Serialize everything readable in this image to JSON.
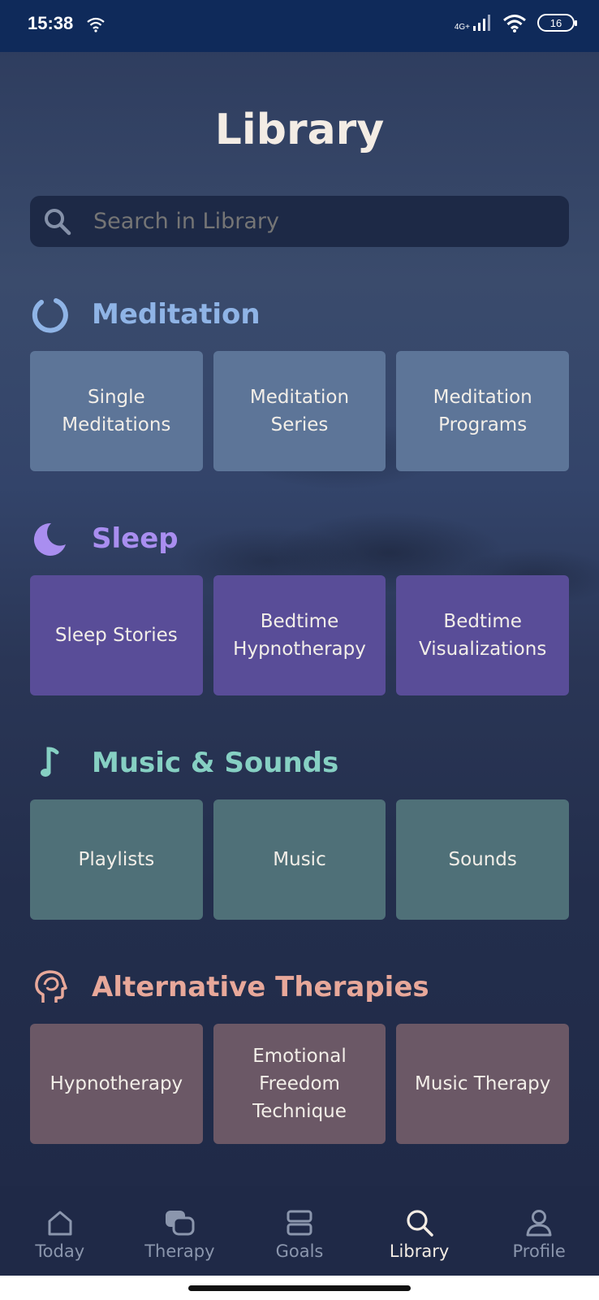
{
  "status_bar": {
    "time": "15:38",
    "network": "4G+",
    "battery": "16"
  },
  "page": {
    "title": "Library"
  },
  "search": {
    "placeholder": "Search in Library"
  },
  "sections": [
    {
      "heading": "Meditation",
      "icon": "circle-ring-icon",
      "color": "#8fb4e6",
      "tiles": [
        {
          "label": "Single Meditations"
        },
        {
          "label": "Meditation Series"
        },
        {
          "label": "Meditation Programs"
        }
      ]
    },
    {
      "heading": "Sleep",
      "icon": "moon-icon",
      "color": "#a98ef0",
      "tiles": [
        {
          "label": "Sleep Stories"
        },
        {
          "label": "Bedtime Hypnotherapy"
        },
        {
          "label": "Bedtime Visualizations"
        }
      ]
    },
    {
      "heading": "Music & Sounds",
      "icon": "music-note-icon",
      "color": "#86d0c3",
      "tiles": [
        {
          "label": "Playlists"
        },
        {
          "label": "Music"
        },
        {
          "label": "Sounds"
        }
      ]
    },
    {
      "heading": "Alternative Therapies",
      "icon": "head-profile-icon",
      "color": "#e8a89a",
      "tiles": [
        {
          "label": "Hypnotherapy"
        },
        {
          "label": "Emotional Freedom Technique"
        },
        {
          "label": "Music Therapy"
        }
      ]
    }
  ],
  "nav": [
    {
      "label": "Today",
      "icon": "home-icon"
    },
    {
      "label": "Therapy",
      "icon": "chat-bubbles-icon"
    },
    {
      "label": "Goals",
      "icon": "stack-icon"
    },
    {
      "label": "Library",
      "icon": "search-icon",
      "active": true
    },
    {
      "label": "Profile",
      "icon": "person-icon"
    }
  ]
}
